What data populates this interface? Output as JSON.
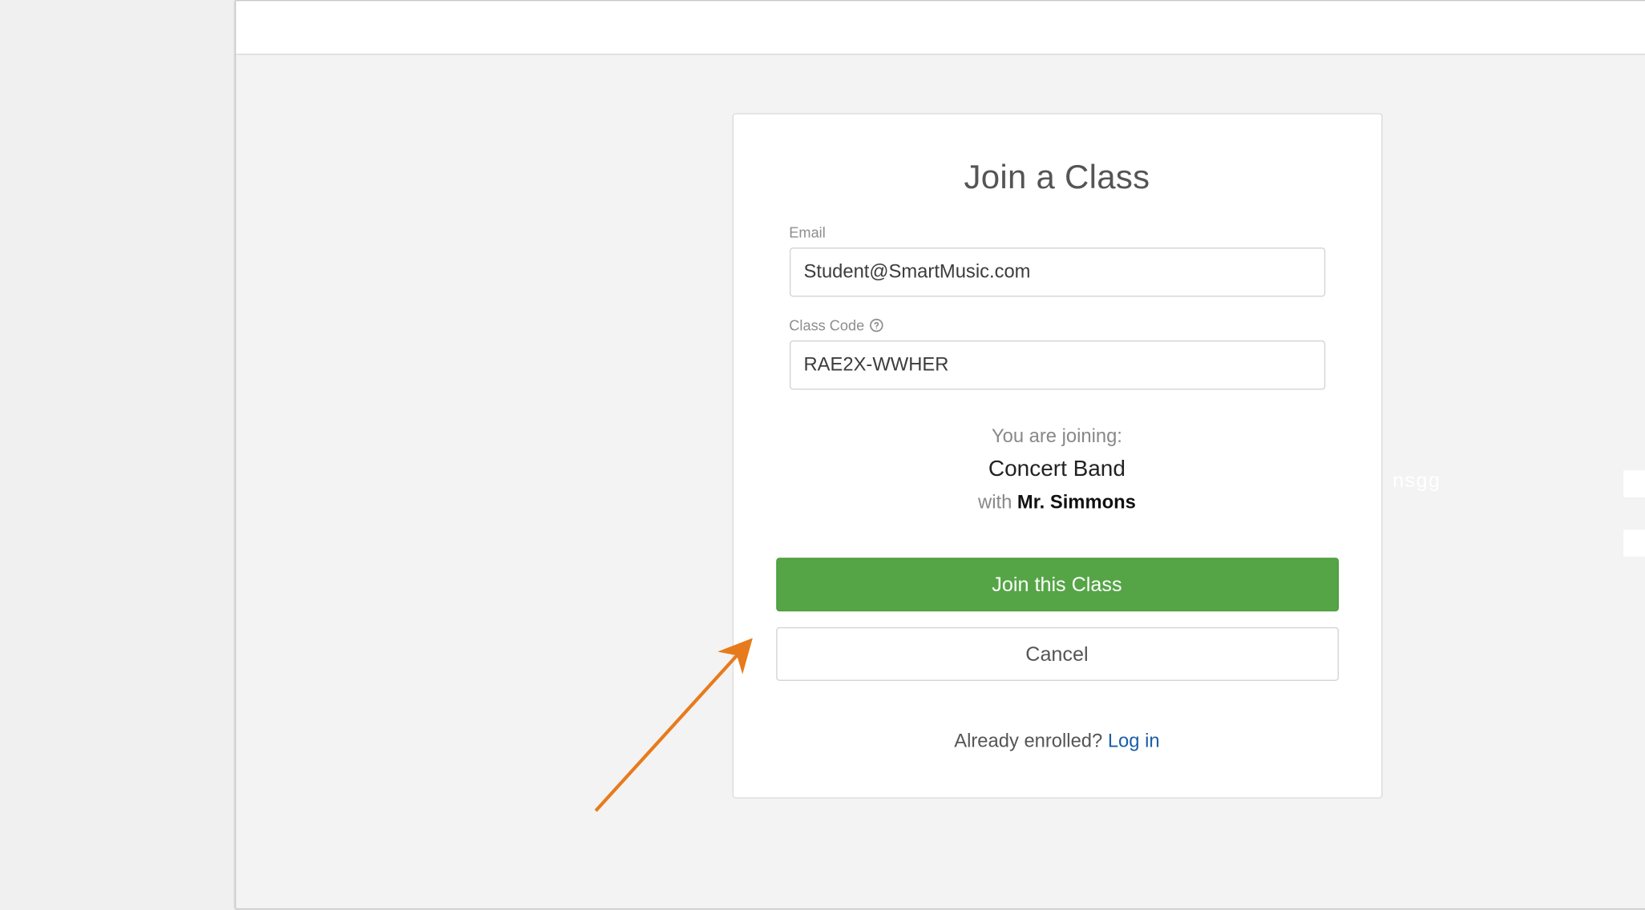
{
  "card": {
    "title": "Join a Class",
    "email_label": "Email",
    "email_value": "Student@SmartMusic.com",
    "classcode_label": "Class Code",
    "classcode_value": "RAE2X-WWHER",
    "joining_intro": "You are joining:",
    "joining_class": "Concert Band",
    "joining_with": "with",
    "joining_teacher": "Mr. Simmons",
    "join_button": "Join this Class",
    "cancel_button": "Cancel",
    "footer_text": "Already enrolled? ",
    "footer_link": "Log in"
  },
  "bg": {
    "fragment": "nsgg"
  }
}
